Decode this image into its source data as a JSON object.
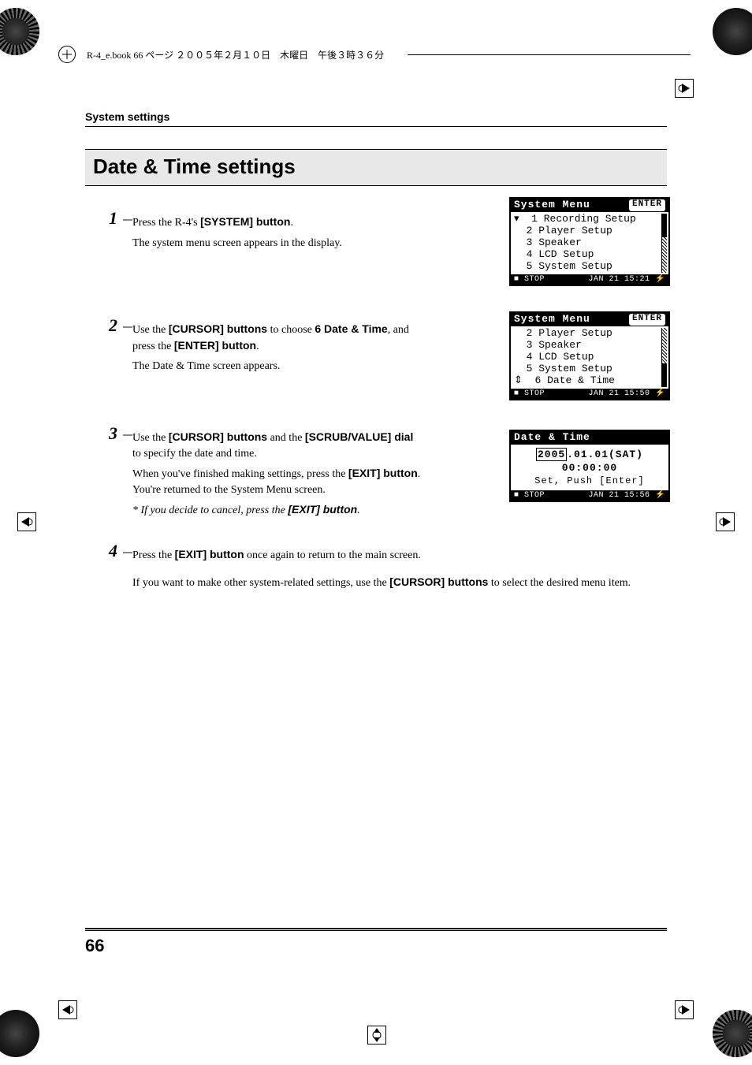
{
  "runhead": "R-4_e.book  66 ページ  ２００５年２月１０日　木曜日　午後３時３６分",
  "section_label": "System settings",
  "title": "Date & Time settings",
  "page_number": "66",
  "steps": {
    "s1": {
      "num": "1",
      "l1a": "Press the R-4's ",
      "l1b": "[SYSTEM] button",
      "l1c": ".",
      "l2": "The system menu screen appears in the display."
    },
    "s2": {
      "num": "2",
      "l1a": "Use the ",
      "l1b": "[CURSOR] buttons",
      "l1c": " to choose ",
      "l1d": "6 Date & Time",
      "l1e": ", and press the ",
      "l1f": "[ENTER] button",
      "l1g": ".",
      "l2": "The Date & Time screen appears."
    },
    "s3": {
      "num": "3",
      "l1a": "Use the ",
      "l1b": "[CURSOR] buttons",
      "l1c": " and the ",
      "l1d": "[SCRUB/VALUE] dial",
      "l1e": " to specify the date and time.",
      "l2a": "When you've finished making settings, press the ",
      "l2b": "[EXIT] button",
      "l2c": ". You're returned to the System Menu screen.",
      "note_a": "*  If you decide to cancel, press the ",
      "note_b": "[EXIT] button",
      "note_c": "."
    },
    "s4": {
      "num": "4",
      "l1a": "Press the ",
      "l1b": "[EXIT] button",
      "l1c": " once again to return to the main screen.",
      "l2a": "If you want to make other system-related settings, use the ",
      "l2b": "[CURSOR] buttons",
      "l2c": " to select the desired menu item."
    }
  },
  "lcd1": {
    "title": "System Menu",
    "title_r": "ENTER",
    "rows": [
      "  1 Recording Setup",
      "  2 Player Setup",
      "  3 Speaker",
      "  4 LCD Setup",
      "  5 System Setup"
    ],
    "sel_row": 0,
    "status_l": "■ STOP",
    "status_r": "JAN 21 15:21 ⚡"
  },
  "lcd2": {
    "title": "System Menu",
    "title_r": "ENTER",
    "rows": [
      "  2 Player Setup",
      "  3 Speaker",
      "  4 LCD Setup",
      "  5 System Setup",
      "  6 Date & Time"
    ],
    "sel_row": 4,
    "status_l": "■ STOP",
    "status_r": "JAN 21 15:50 ⚡"
  },
  "lcd3": {
    "title": "Date & Time",
    "year": "2005",
    "date_rest": ".01.01(SAT)",
    "time": "00:00:00",
    "hint": "Set, Push [Enter]",
    "status_l": "■ STOP",
    "status_r": "JAN 21 15:56 ⚡"
  }
}
